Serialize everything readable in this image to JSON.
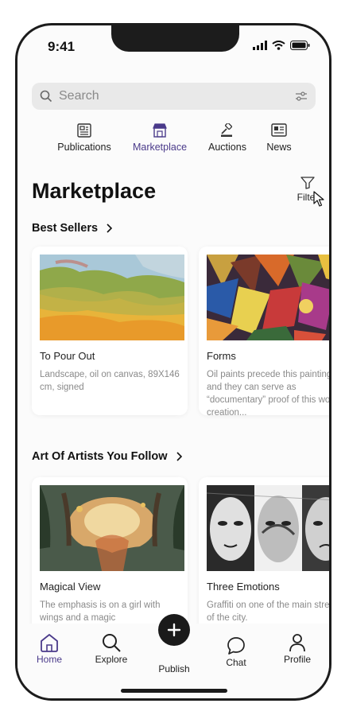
{
  "status": {
    "time": "9:41"
  },
  "search": {
    "placeholder": "Search"
  },
  "categories": [
    {
      "label": "Publications",
      "icon": "newspaper-icon",
      "active": false
    },
    {
      "label": "Marketplace",
      "icon": "store-icon",
      "active": true
    },
    {
      "label": "Auctions",
      "icon": "gavel-icon",
      "active": false
    },
    {
      "label": "News",
      "icon": "news-icon",
      "active": false
    }
  ],
  "page": {
    "title": "Marketplace",
    "filter_label": "Filter"
  },
  "best_sellers": {
    "title": "Best Sellers",
    "items": [
      {
        "title": "To Pour Out",
        "desc": "Landscape, oil on canvas, 89X146 cm, signed"
      },
      {
        "title": "Forms",
        "desc": "Oil paints precede this painting, and they can serve as “documentary” proof of this work creation..."
      }
    ]
  },
  "following": {
    "title": "Art Of Artists You Follow",
    "items": [
      {
        "title": "Magical View",
        "desc": "The emphasis is on a girl with wings and a magic"
      },
      {
        "title": "Three Emotions",
        "desc": "Graffiti on one of the main streets of the city."
      }
    ]
  },
  "tabbar": {
    "home": "Home",
    "explore": "Explore",
    "publish": "Publish",
    "chat": "Chat",
    "profile": "Profile"
  },
  "colors": {
    "accent": "#4a3a8a",
    "dark": "#1a1a1a"
  }
}
